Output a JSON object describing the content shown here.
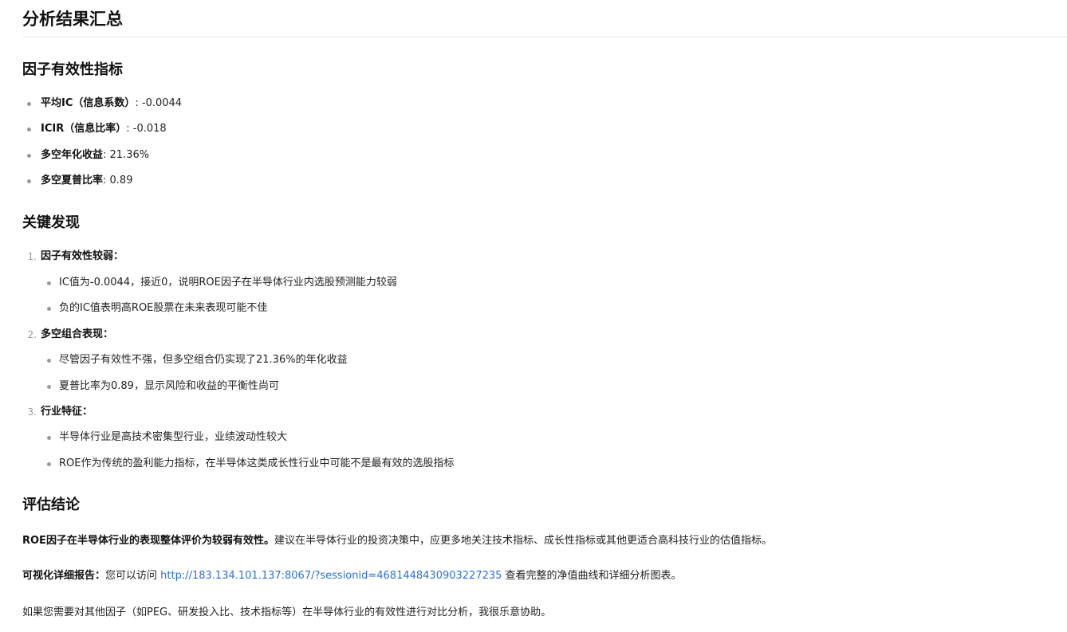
{
  "page_title": "分析结果汇总",
  "section_metrics": {
    "heading": "因子有效性指标",
    "items": [
      {
        "label": "平均IC（信息系数）",
        "value": ": -0.0044"
      },
      {
        "label": "ICIR（信息比率）",
        "value": ": -0.018"
      },
      {
        "label": "多空年化收益",
        "value": ": 21.36%"
      },
      {
        "label": "多空夏普比率",
        "value": ": 0.89"
      }
    ]
  },
  "section_findings": {
    "heading": "关键发现",
    "groups": [
      {
        "number": "1.",
        "title": "因子有效性较弱：",
        "points": [
          "IC值为-0.0044，接近0，说明ROE因子在半导体行业内选股预测能力较弱",
          "负的IC值表明高ROE股票在未来表现可能不佳"
        ]
      },
      {
        "number": "2.",
        "title": "多空组合表现：",
        "points": [
          "尽管因子有效性不强，但多空组合仍实现了21.36%的年化收益",
          "夏普比率为0.89，显示风险和收益的平衡性尚可"
        ]
      },
      {
        "number": "3.",
        "title": "行业特征：",
        "points": [
          "半导体行业是高技术密集型行业，业绩波动性较大",
          "ROE作为传统的盈利能力指标，在半导体这类成长性行业中可能不是最有效的选股指标"
        ]
      }
    ]
  },
  "section_conclusion": {
    "heading": "评估结论",
    "para1_bold": "ROE因子在半导体行业的表现整体评价为较弱有效性。",
    "para1_text": "建议在半导体行业的投资决策中，应更多地关注技术指标、成长性指标或其他更适合高科技行业的估值指标。",
    "para2_bold": "可视化详细报告：",
    "para2_text_before": "您可以访问 ",
    "para2_link": "http://183.134.101.137:8067/?sessionid=4681448430903227235",
    "para2_text_after": " 查看完整的净值曲线和详细分析图表。",
    "para3_text": "如果您需要对其他因子（如PEG、研发投入比、技术指标等）在半导体行业的有效性进行对比分析，我很乐意协助。"
  },
  "colors": {
    "link": "#2f6fd0",
    "bullet": "#9a9a9a",
    "rule": "#e8e8e8"
  }
}
